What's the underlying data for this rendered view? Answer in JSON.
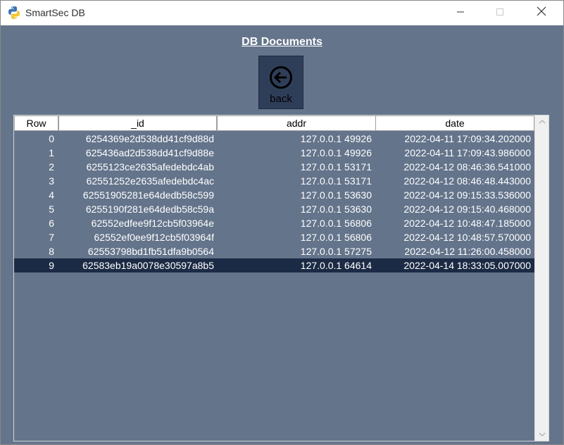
{
  "window": {
    "title": "SmartSec DB",
    "icon": "python-icon",
    "controls": [
      "minimize-icon",
      "maximize-icon",
      "close-icon"
    ]
  },
  "page": {
    "heading": "DB Documents",
    "back_button": {
      "label": "back",
      "icon": "arrow-left-circle-icon"
    }
  },
  "table": {
    "columns": [
      "Row",
      "_id",
      "addr",
      "date"
    ],
    "rows": [
      {
        "row": "0",
        "id": "6254369e2d538dd41cf9d88d",
        "addr": "127.0.0.1 49926",
        "date": "2022-04-11 17:09:34.202000"
      },
      {
        "row": "1",
        "id": "625436ad2d538dd41cf9d88e",
        "addr": "127.0.0.1 49926",
        "date": "2022-04-11 17:09:43.986000"
      },
      {
        "row": "2",
        "id": "6255123ce2635afedebdc4ab",
        "addr": "127.0.0.1 53171",
        "date": "2022-04-12 08:46:36.541000"
      },
      {
        "row": "3",
        "id": "62551252e2635afedebdc4ac",
        "addr": "127.0.0.1 53171",
        "date": "2022-04-12 08:46:48.443000"
      },
      {
        "row": "4",
        "id": "62551905281e64dedb58c599",
        "addr": "127.0.0.1 53630",
        "date": "2022-04-12 09:15:33.536000"
      },
      {
        "row": "5",
        "id": "6255190f281e64dedb58c59a",
        "addr": "127.0.0.1 53630",
        "date": "2022-04-12 09:15:40.468000"
      },
      {
        "row": "6",
        "id": "62552edfee9f12cb5f03964e",
        "addr": "127.0.0.1 56806",
        "date": "2022-04-12 10:48:47.185000"
      },
      {
        "row": "7",
        "id": "62552ef0ee9f12cb5f03964f",
        "addr": "127.0.0.1 56806",
        "date": "2022-04-12 10:48:57.570000"
      },
      {
        "row": "8",
        "id": "62553798bd1fb51dfa9b0564",
        "addr": "127.0.0.1 57275",
        "date": "2022-04-12 11:26:00.458000"
      },
      {
        "row": "9",
        "id": "62583eb19a0078e30597a8b5",
        "addr": "127.0.0.1 64614",
        "date": "2022-04-14 18:33:05.007000"
      }
    ],
    "selected_row": 9
  },
  "colors": {
    "background": "#64748b",
    "selection": "#1c2b45",
    "button": "#2f3e58"
  }
}
